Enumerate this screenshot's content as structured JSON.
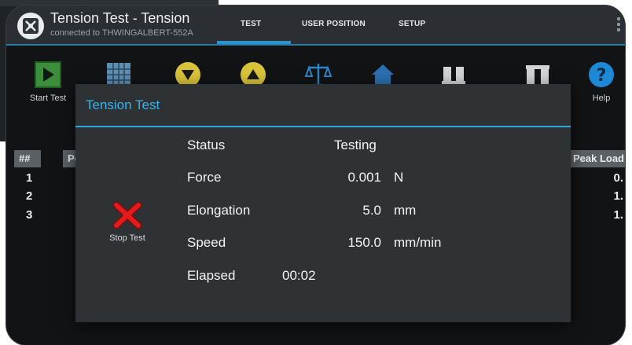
{
  "app": {
    "title": "Tension Test - Tension",
    "subtitle": "connected to THWINGALBERT-552A"
  },
  "tabs": [
    {
      "label": "TEST",
      "active": true
    },
    {
      "label": "USER POSITION",
      "active": false
    },
    {
      "label": "SETUP",
      "active": false
    }
  ],
  "toolbar": {
    "start_test": "Start Test",
    "help": "Help"
  },
  "table": {
    "headers": [
      "##",
      "Pe",
      "Peak Load"
    ],
    "rows": [
      {
        "num": "1",
        "peak": "0."
      },
      {
        "num": "2",
        "peak": "1."
      },
      {
        "num": "3",
        "peak": "1."
      }
    ]
  },
  "dialog": {
    "title": "Tension Test",
    "stop_label": "Stop Test",
    "status_label": "Status",
    "status_value": "Testing",
    "force_label": "Force",
    "force_value": "0.001",
    "force_unit": "N",
    "elongation_label": "Elongation",
    "elongation_value": "5.0",
    "elongation_unit": "mm",
    "speed_label": "Speed",
    "speed_value": "150.0",
    "speed_unit": "mm/min",
    "elapsed_label": "Elapsed",
    "elapsed_value": "00:02"
  },
  "colors": {
    "accent": "#31a8dc",
    "play_green": "#3c8d3c",
    "arrow_yellow": "#d9c33a",
    "help_blue": "#1e88d8",
    "stop_red": "#e21b1b"
  },
  "icons": [
    "app-logo-icon",
    "start-test-icon",
    "table-icon",
    "arrow-down-icon",
    "arrow-up-icon",
    "scale-icon",
    "home-icon",
    "grips-close-icon",
    "grips-open-icon",
    "help-icon",
    "stop-icon"
  ]
}
